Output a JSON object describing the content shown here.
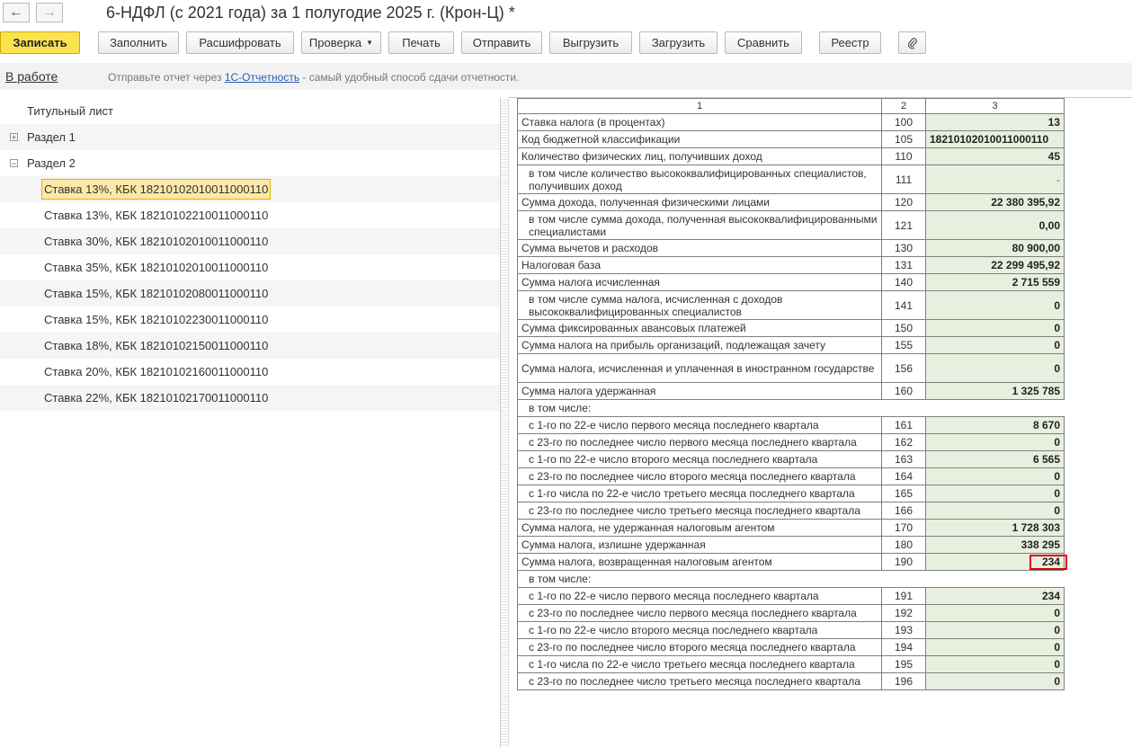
{
  "header": {
    "title": "6-НДФЛ (с 2021 года) за 1 полугодие 2025 г. (Крон-Ц) *",
    "back_icon": "arrow-left",
    "forward_icon": "arrow-right"
  },
  "toolbar": {
    "save": "Записать",
    "fill": "Заполнить",
    "decode": "Расшифровать",
    "check": "Проверка",
    "print": "Печать",
    "send": "Отправить",
    "export": "Выгрузить",
    "import": "Загрузить",
    "compare": "Сравнить",
    "registry": "Реестр",
    "attach_icon": "paperclip"
  },
  "infobar": {
    "status": "В работе",
    "text_before": "Отправьте отчет через ",
    "link": "1С-Отчетность",
    "text_after": " - самый удобный способ сдачи отчетности."
  },
  "tree": [
    {
      "label": "Титульный лист",
      "expander": ""
    },
    {
      "label": "Раздел 1",
      "expander": "+"
    },
    {
      "label": "Раздел 2",
      "expander": "−"
    },
    {
      "label": "Ставка 13%, КБК 18210102010011000110",
      "expander": "",
      "selected": true
    },
    {
      "label": "Ставка 13%, КБК 18210102210011000110",
      "expander": ""
    },
    {
      "label": "Ставка 30%, КБК 18210102010011000110",
      "expander": ""
    },
    {
      "label": "Ставка 35%, КБК 18210102010011000110",
      "expander": ""
    },
    {
      "label": "Ставка 15%, КБК 18210102080011000110",
      "expander": ""
    },
    {
      "label": "Ставка 15%, КБК 18210102230011000110",
      "expander": ""
    },
    {
      "label": "Ставка 18%, КБК 18210102150011000110",
      "expander": ""
    },
    {
      "label": "Ставка 20%, КБК 18210102160011000110",
      "expander": ""
    },
    {
      "label": "Ставка 22%, КБК 18210102170011000110",
      "expander": ""
    }
  ],
  "report": {
    "col_headers": [
      "1",
      "2",
      "3"
    ],
    "rows": [
      {
        "name": "Ставка налога (в процентах)",
        "code": "100",
        "value": "13"
      },
      {
        "name": "Код бюджетной классификации",
        "code": "105",
        "value": "18210102010011000110",
        "left": true
      },
      {
        "name": "Количество физических лиц, получивших доход",
        "code": "110",
        "value": "45"
      },
      {
        "name": "в том числе количество высококвалифицированных специалистов, получивших доход",
        "code": "111",
        "value": "-",
        "indent": true,
        "tall": true,
        "muted": true
      },
      {
        "name": "Сумма дохода, полученная физическими лицами",
        "code": "120",
        "value": "22 380 395,92"
      },
      {
        "name": "в том числе сумма дохода, полученная высококвалифицированными специалистами",
        "code": "121",
        "value": "0,00",
        "indent": true,
        "tall": true
      },
      {
        "name": "Сумма вычетов и расходов",
        "code": "130",
        "value": "80 900,00"
      },
      {
        "name": "Налоговая база",
        "code": "131",
        "value": "22 299 495,92"
      },
      {
        "name": "Сумма налога исчисленная",
        "code": "140",
        "value": "2 715 559"
      },
      {
        "name": "в том числе сумма налога, исчисленная с доходов высококвалифицированных специалистов",
        "code": "141",
        "value": "0",
        "indent": true,
        "tall": true
      },
      {
        "name": "Сумма фиксированных авансовых платежей",
        "code": "150",
        "value": "0"
      },
      {
        "name": "Сумма налога на прибыль организаций, подлежащая зачету",
        "code": "155",
        "value": "0"
      },
      {
        "name": "Сумма налога, исчисленная и уплаченная в иностранном государстве",
        "code": "156",
        "value": "0",
        "tall": true
      },
      {
        "name": "Сумма налога удержанная",
        "code": "160",
        "value": "1 325 785"
      },
      {
        "name": "в том числе:",
        "note": true,
        "indent": true
      },
      {
        "name": "с 1-го по 22-е число первого месяца последнего квартала",
        "code": "161",
        "value": "8 670",
        "indent": true
      },
      {
        "name": "с 23-го по последнее число первого месяца последнего квартала",
        "code": "162",
        "value": "0",
        "indent": true
      },
      {
        "name": "с 1-го по 22-е число второго месяца последнего квартала",
        "code": "163",
        "value": "6 565",
        "indent": true
      },
      {
        "name": "с 23-го по последнее число второго месяца последнего квартала",
        "code": "164",
        "value": "0",
        "indent": true
      },
      {
        "name": "с 1-го числа по 22-е число третьего месяца последнего квартала",
        "code": "165",
        "value": "0",
        "indent": true
      },
      {
        "name": "с 23-го по последнее число третьего месяца последнего квартала",
        "code": "166",
        "value": "0",
        "indent": true
      },
      {
        "name": "Сумма налога, не удержанная налоговым агентом",
        "code": "170",
        "value": "1 728 303"
      },
      {
        "name": "Сумма налога, излишне удержанная",
        "code": "180",
        "value": "338 295"
      },
      {
        "name": "Сумма налога, возвращенная налоговым агентом",
        "code": "190",
        "value": "234",
        "highlight": true
      },
      {
        "name": "в том числе:",
        "note": true,
        "indent": true
      },
      {
        "name": "с 1-го по 22-е число первого месяца последнего квартала",
        "code": "191",
        "value": "234",
        "indent": true
      },
      {
        "name": "с 23-го по последнее число первого месяца последнего квартала",
        "code": "192",
        "value": "0",
        "indent": true
      },
      {
        "name": "с 1-го по 22-е число второго месяца последнего квартала",
        "code": "193",
        "value": "0",
        "indent": true
      },
      {
        "name": "с 23-го по последнее число второго месяца последнего квартала",
        "code": "194",
        "value": "0",
        "indent": true
      },
      {
        "name": "с 1-го числа по 22-е число третьего месяца последнего квартала",
        "code": "195",
        "value": "0",
        "indent": true
      },
      {
        "name": "с 23-го по последнее число третьего месяца последнего квартала",
        "code": "196",
        "value": "0",
        "indent": true
      }
    ]
  }
}
